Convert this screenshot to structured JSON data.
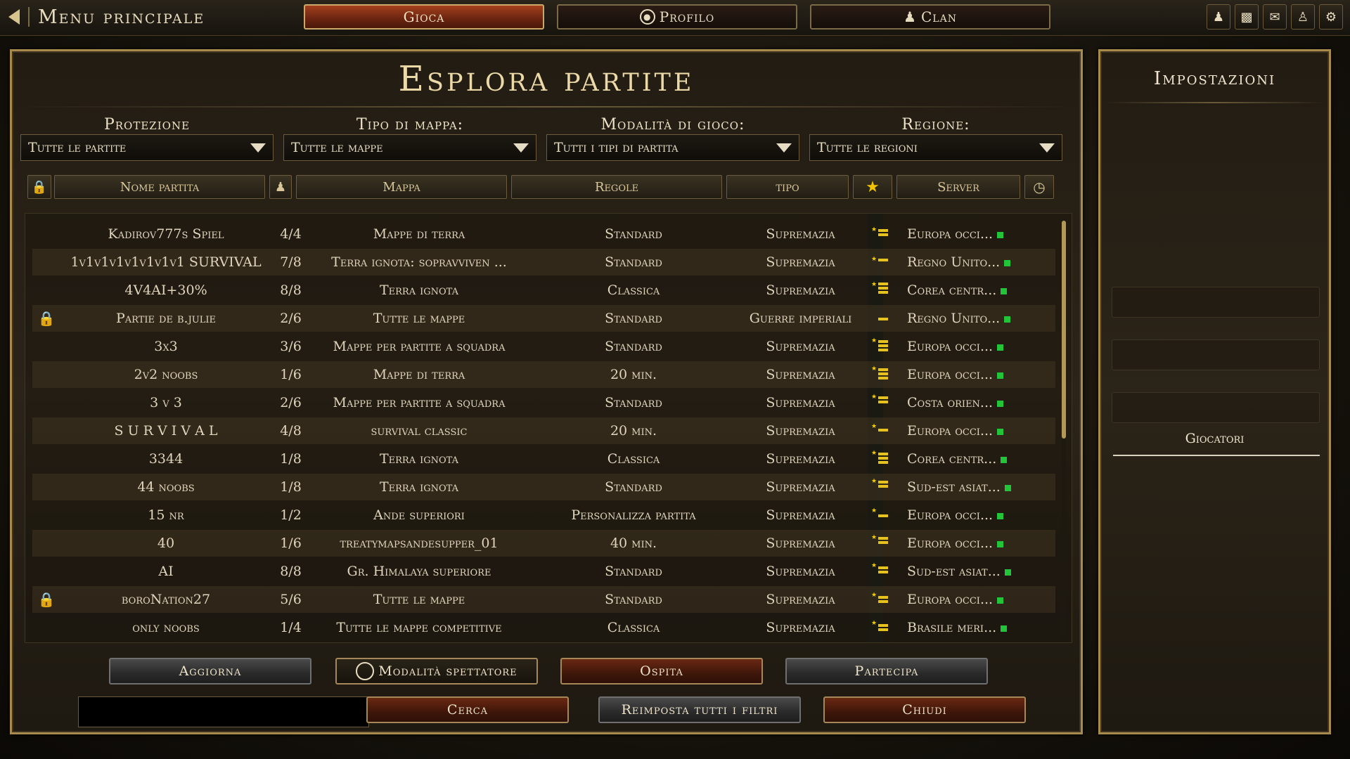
{
  "topbar": {
    "back_label": "Menu principale",
    "tabs": [
      {
        "label": "Gioca",
        "icon": "",
        "active": true
      },
      {
        "label": "Profilo",
        "icon": "profile-icon",
        "active": false
      },
      {
        "label": "Clan",
        "icon": "person-icon",
        "active": false
      }
    ],
    "icons": [
      "person-icon",
      "bar-chart-icon",
      "chat-icon",
      "group-icon",
      "gear-icon"
    ]
  },
  "main": {
    "title": "Esplora partite",
    "filters": [
      {
        "label": "Protezione",
        "value": "Tutte le partite"
      },
      {
        "label": "Tipo di mappa:",
        "value": "Tutte le mappe"
      },
      {
        "label": "Modalità di gioco:",
        "value": "Tutti i tipi di partita"
      },
      {
        "label": "Regione:",
        "value": "Tutte le regioni"
      }
    ],
    "columns": {
      "name": "Nome partita",
      "map": "Mappa",
      "rules": "Regole",
      "type": "tipo",
      "server": "Server"
    },
    "rows": [
      {
        "locked": false,
        "name": "Kadirov777s Spiel",
        "players": "4/4",
        "map": "Mappe di terra",
        "rules": "Standard",
        "type": "Supremazia",
        "server": "Europa occi..."
      },
      {
        "locked": false,
        "name": "1v1v1v1v1v1v1v1 SURVIVAL",
        "players": "7/8",
        "map": "Terra ignota: sopravviven ...",
        "rules": "Standard",
        "type": "Supremazia",
        "server": "Regno Unito..."
      },
      {
        "locked": false,
        "name": "4V4AI+30%",
        "players": "8/8",
        "map": "Terra ignota",
        "rules": "Classica",
        "type": "Supremazia",
        "server": "Corea centr..."
      },
      {
        "locked": true,
        "name": "Partie de b.julie",
        "players": "2/6",
        "map": "Tutte le mappe",
        "rules": "Standard",
        "type": "Guerre imperiali",
        "server": "Regno Unito..."
      },
      {
        "locked": false,
        "name": "3x3",
        "players": "3/6",
        "map": "Mappe per partite a squadra",
        "rules": "Standard",
        "type": "Supremazia",
        "server": "Europa occi..."
      },
      {
        "locked": false,
        "name": "2v2 noobs",
        "players": "1/6",
        "map": "Mappe di terra",
        "rules": "20 min.",
        "type": "Supremazia",
        "server": "Europa occi..."
      },
      {
        "locked": false,
        "name": "3 v 3",
        "players": "2/6",
        "map": "Mappe per partite a squadra",
        "rules": "Standard",
        "type": "Supremazia",
        "server": "Costa orien..."
      },
      {
        "locked": false,
        "name": "S U R V I V A L",
        "players": "4/8",
        "map": "survival classic",
        "rules": "20 min.",
        "type": "Supremazia",
        "server": "Europa occi..."
      },
      {
        "locked": false,
        "name": "3344",
        "players": "1/8",
        "map": "Terra ignota",
        "rules": "Classica",
        "type": "Supremazia",
        "server": "Corea centr..."
      },
      {
        "locked": false,
        "name": "44 noobs",
        "players": "1/8",
        "map": "Terra ignota",
        "rules": "Standard",
        "type": "Supremazia",
        "server": "Sud-est asiat..."
      },
      {
        "locked": false,
        "name": "15 nr",
        "players": "1/2",
        "map": "Ande superiori",
        "rules": "Personalizza partita",
        "type": "Supremazia",
        "server": "Europa occi..."
      },
      {
        "locked": false,
        "name": "40",
        "players": "1/6",
        "map": "treatymapsandesupper_01",
        "rules": "40 min.",
        "type": "Supremazia",
        "server": "Europa occi..."
      },
      {
        "locked": false,
        "name": "AI",
        "players": "8/8",
        "map": "Gr. Himalaya superiore",
        "rules": "Standard",
        "type": "Supremazia",
        "server": "Sud-est asiat..."
      },
      {
        "locked": true,
        "name": "boroNation27",
        "players": "5/6",
        "map": "Tutte le mappe",
        "rules": "Standard",
        "type": "Supremazia",
        "server": "Europa occi..."
      },
      {
        "locked": false,
        "name": "only noobs",
        "players": "1/4",
        "map": "Tutte le mappe competitive",
        "rules": "Classica",
        "type": "Supremazia",
        "server": "Brasile meri..."
      }
    ],
    "buttons": {
      "refresh": "Aggiorna",
      "spectator": "Modalità spettatore",
      "host": "Ospita",
      "join": "Partecipa",
      "search": "Cerca",
      "reset": "Reimposta tutti i filtri",
      "close": "Chiudi"
    },
    "search_value": ""
  },
  "side": {
    "title": "Impostazioni",
    "players_label": "Giocatori"
  },
  "colors": {
    "accent": "#a88b4c",
    "active_tab": "#8a3216",
    "ping": "#22c43a"
  }
}
